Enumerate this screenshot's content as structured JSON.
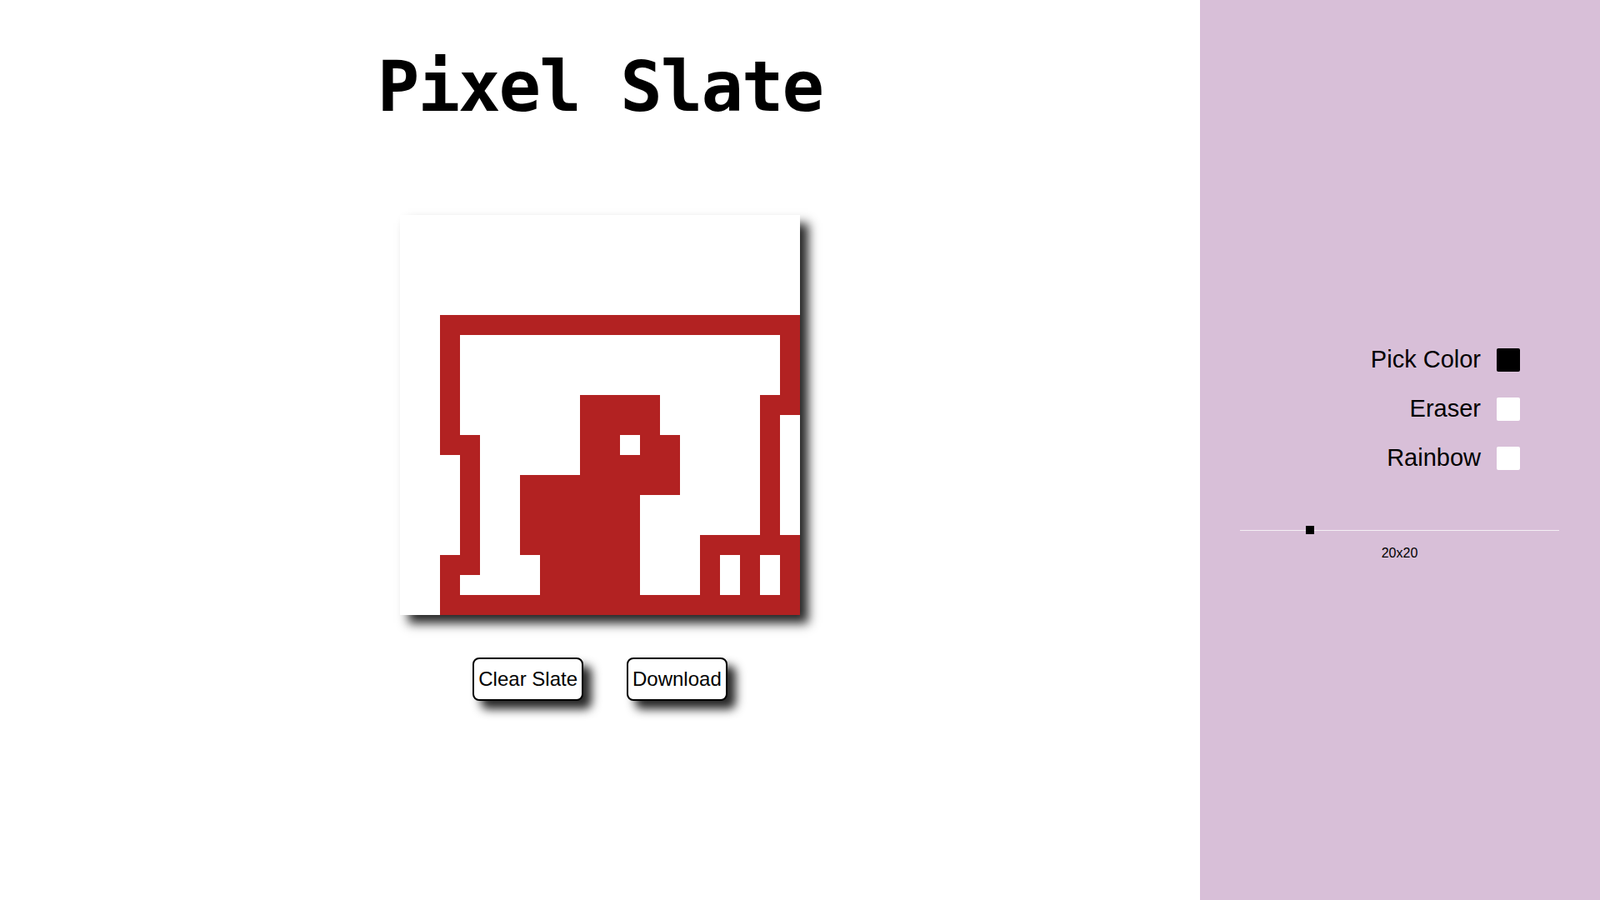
{
  "title": "Pixel Slate",
  "canvas": {
    "size": "20x20",
    "palette": {
      ".": "#ffffff",
      "R": "#b22222"
    },
    "rows": [
      "....................",
      "....................",
      "....................",
      "....................",
      "....................",
      "..RRRRRRRRRRRRRRRRRR",
      "..R................R",
      "..R................R",
      "..R................R",
      "..R......RRRR.....RR",
      "..R......RRRR.....R.",
      "..RR.....RR.RR....R.",
      "...R.....RRRRR....R.",
      "...R..RRRRRRRR....R.",
      "...R..RRRRRR......R.",
      "...R..RRRRRR......R.",
      "...R..RRRRRR...RRRRR",
      "..RR...RRRRR...R.R.R",
      "..R....RRRRR...R.R.R",
      "..RRRRRRRRRRRRRRRRRR"
    ]
  },
  "buttons": [
    "Clear Slate",
    "Download"
  ],
  "tools": [
    {
      "label": "Pick Color",
      "kind": "color",
      "color": "#000000"
    },
    {
      "label": "Eraser",
      "kind": "toggle",
      "on": false
    },
    {
      "label": "Rainbow",
      "kind": "toggle",
      "on": false
    }
  ],
  "slider": {
    "level": 0.22,
    "reading": "20x20"
  }
}
